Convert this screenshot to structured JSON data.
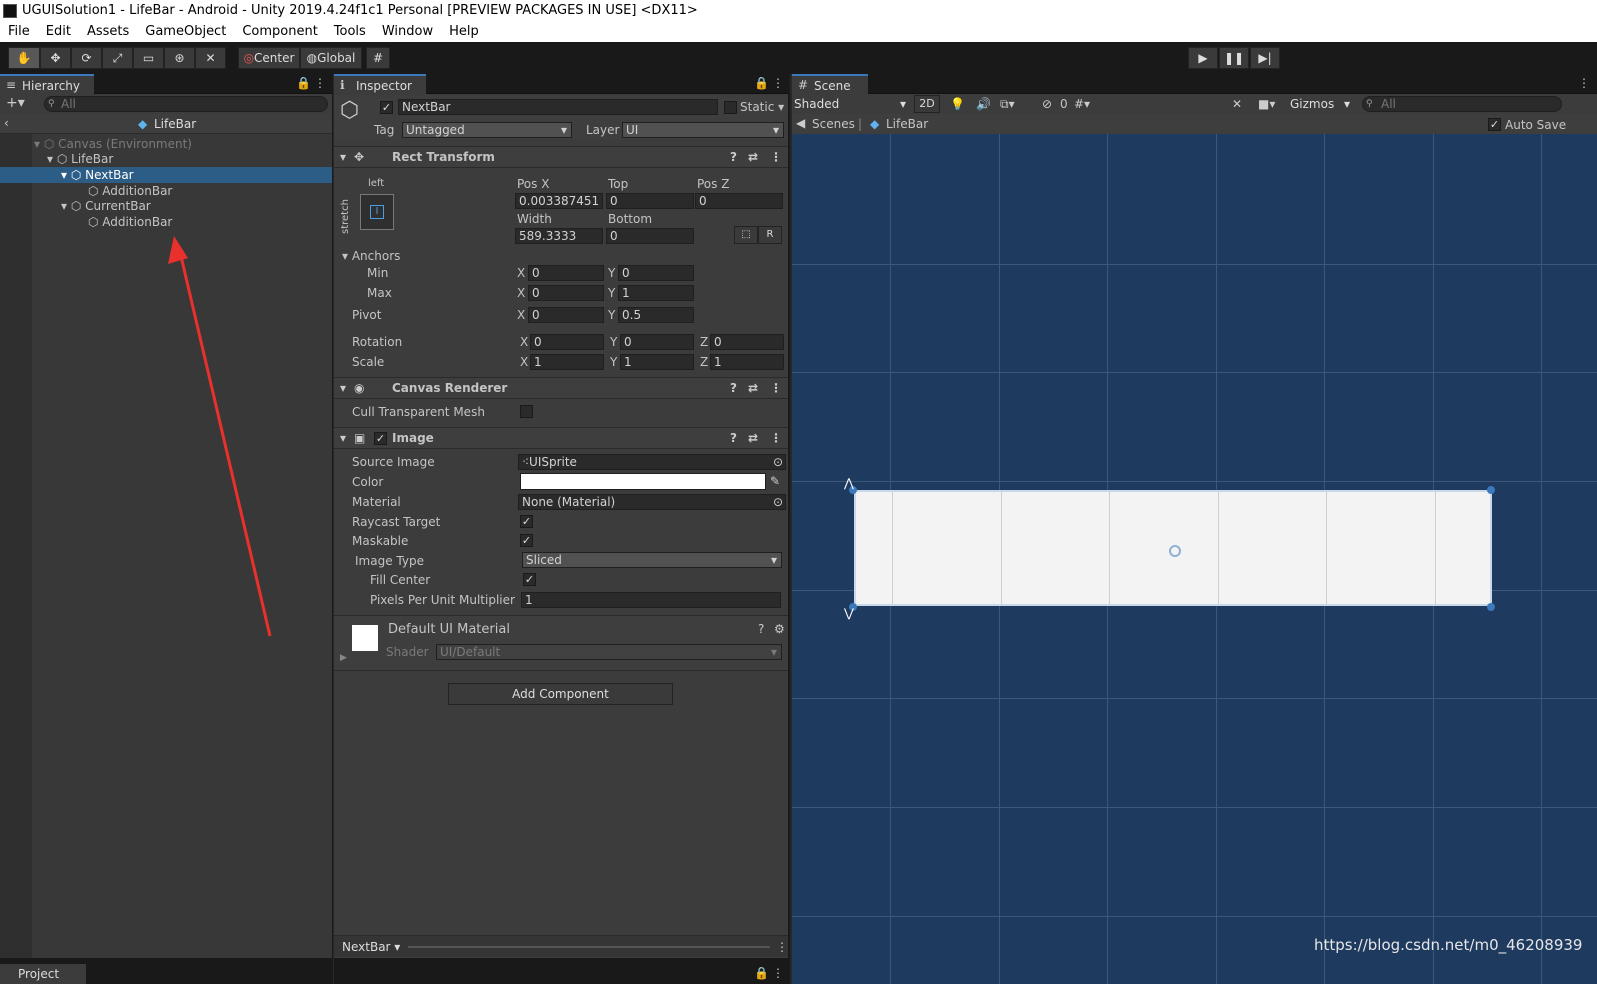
{
  "window": {
    "title": "UGUISolution1 - LifeBar - Android - Unity 2019.4.24f1c1 Personal [PREVIEW PACKAGES IN USE] <DX11>"
  },
  "menu": [
    "File",
    "Edit",
    "Assets",
    "GameObject",
    "Component",
    "Tools",
    "Window",
    "Help"
  ],
  "toolbar": {
    "center_label": "Center",
    "global_label": "Global"
  },
  "hierarchy": {
    "tab": "Hierarchy",
    "search_placeholder": "All",
    "breadcrumb": "LifeBar",
    "items": [
      {
        "label": "Canvas (Environment)"
      },
      {
        "label": "LifeBar"
      },
      {
        "label": "NextBar"
      },
      {
        "label": "AdditionBar"
      },
      {
        "label": "CurrentBar"
      },
      {
        "label": "AdditionBar"
      }
    ],
    "bottom_tab": "Project"
  },
  "inspector": {
    "tab": "Inspector",
    "object_name": "NextBar",
    "static_label": "Static",
    "tag_label": "Tag",
    "tag_value": "Untagged",
    "layer_label": "Layer",
    "layer_value": "UI",
    "rect_transform": {
      "title": "Rect Transform",
      "anchor_h": "left",
      "anchor_v": "stretch",
      "posx_label": "Pos X",
      "top_label": "Top",
      "posz_label": "Pos Z",
      "posx": "0.003387451",
      "top": "0",
      "posz": "0",
      "width_label": "Width",
      "bottom_label": "Bottom",
      "width": "589.3333",
      "bottom": "0",
      "r_label": "R",
      "anchors_label": "Anchors",
      "min_label": "Min",
      "min_x": "0",
      "min_y": "0",
      "max_label": "Max",
      "max_x": "0",
      "max_y": "1",
      "pivot_label": "Pivot",
      "pivot_x": "0",
      "pivot_y": "0.5",
      "rotation_label": "Rotation",
      "rot_x": "0",
      "rot_y": "0",
      "rot_z": "0",
      "scale_label": "Scale",
      "scale_x": "1",
      "scale_y": "1",
      "scale_z": "1",
      "x": "X",
      "y": "Y",
      "z": "Z"
    },
    "canvas_renderer": {
      "title": "Canvas Renderer",
      "cull_label": "Cull Transparent Mesh"
    },
    "image": {
      "title": "Image",
      "source_label": "Source Image",
      "source_value": "UISprite",
      "color_label": "Color",
      "material_label": "Material",
      "material_value": "None (Material)",
      "raycast_label": "Raycast Target",
      "maskable_label": "Maskable",
      "type_label": "Image Type",
      "type_value": "Sliced",
      "fill_label": "Fill Center",
      "ppu_label": "Pixels Per Unit Multiplier",
      "ppu_value": "1"
    },
    "material": {
      "name": "Default UI Material",
      "shader_label": "Shader",
      "shader_value": "UI/Default"
    },
    "add_component": "Add Component",
    "footer": "NextBar"
  },
  "scene": {
    "tab": "Scene",
    "shading": "Shaded",
    "mode_2d": "2D",
    "hidden_count": "0",
    "gizmos": "Gizmos",
    "search_placeholder": "All",
    "breadcrumb_scenes": "Scenes",
    "breadcrumb_prefab": "LifeBar",
    "autosave": "Auto Save",
    "watermark": "https://blog.csdn.net/m0_46208939"
  },
  "colors": {
    "selection": "#2c5d87",
    "scene_bg": "#1e3a5f",
    "accent": "#3a79bb",
    "arrow": "#e8302c"
  }
}
